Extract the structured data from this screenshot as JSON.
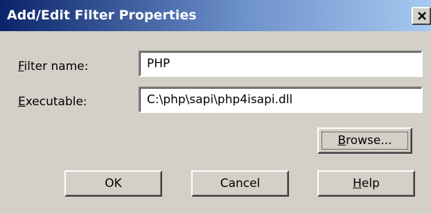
{
  "dialog": {
    "title": "Add/Edit Filter Properties",
    "close_glyph": "×"
  },
  "form": {
    "filter_name": {
      "label_access_key": "F",
      "label_rest": "ilter name:",
      "value": "PHP"
    },
    "executable": {
      "label_access_key": "E",
      "label_rest": "xecutable:",
      "value": "C:\\php\\sapi\\php4isapi.dll"
    }
  },
  "buttons": {
    "browse": {
      "access_key": "B",
      "rest": "rowse..."
    },
    "ok": {
      "label": "OK"
    },
    "cancel": {
      "label": "Cancel"
    },
    "help": {
      "access_key": "H",
      "rest": "elp"
    }
  },
  "icons": {
    "close": "close-icon"
  }
}
